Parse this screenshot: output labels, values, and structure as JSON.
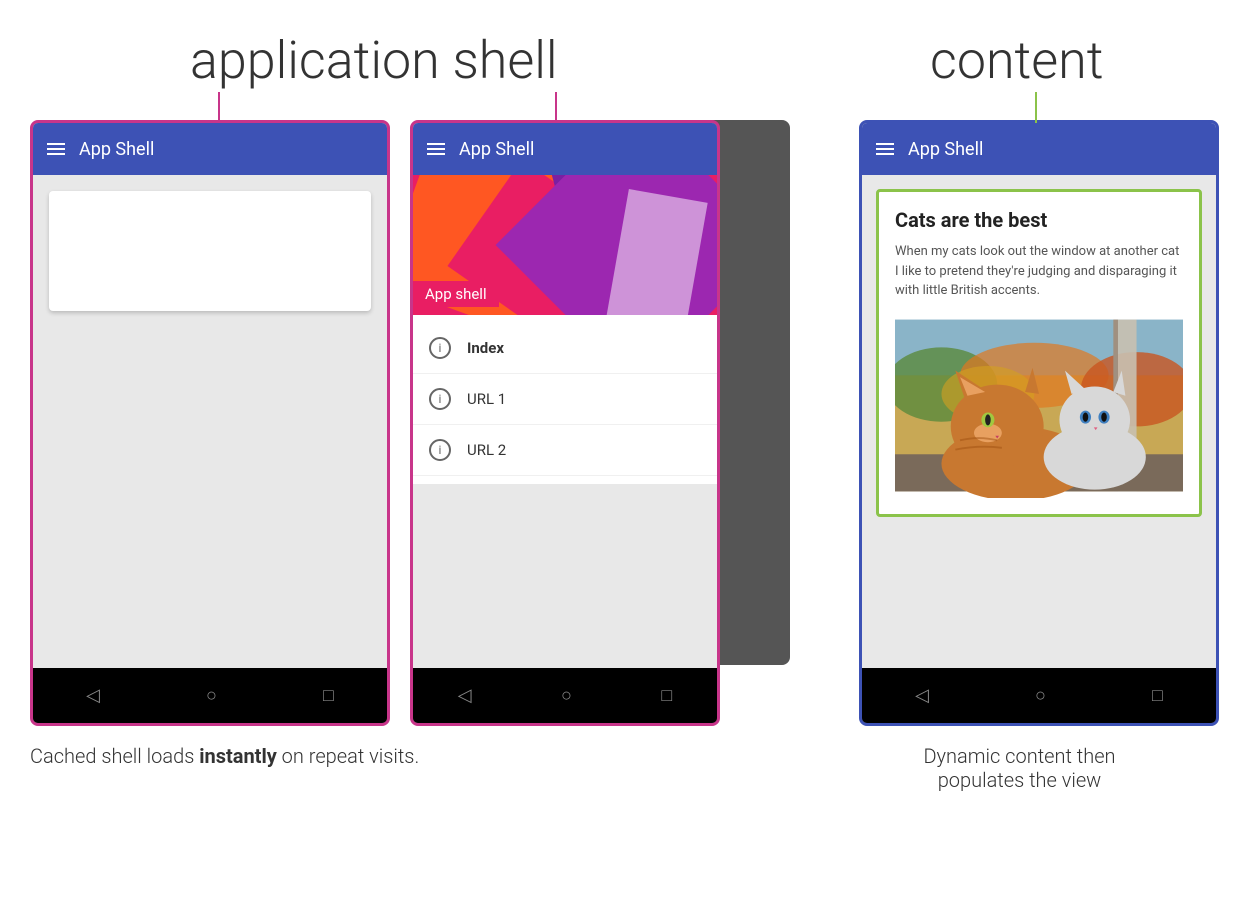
{
  "labels": {
    "app_shell_heading": "application shell",
    "content_heading": "content"
  },
  "phones": {
    "phone1": {
      "toolbar_title": "App Shell",
      "border_color": "#c8358a"
    },
    "phone2": {
      "toolbar_title": "App Shell",
      "border_color": "#c8358a",
      "header_label": "App shell",
      "menu_items": [
        {
          "label": "Index",
          "bold": true
        },
        {
          "label": "URL 1",
          "bold": false
        },
        {
          "label": "URL 2",
          "bold": false
        }
      ]
    },
    "phone3": {
      "toolbar_title": "App Shell",
      "border_color": "#3d52b5",
      "content": {
        "title": "Cats are the best",
        "body": "When my cats look out the window at another cat I like to pretend they're judging and disparaging it with little British accents."
      }
    }
  },
  "nav_icons": {
    "back": "◁",
    "home": "○",
    "recent": "□"
  },
  "captions": {
    "left": "Cached shell loads ",
    "left_bold": "instantly",
    "left_suffix": " on repeat visits.",
    "right_line1": "Dynamic content then",
    "right_line2": "populates the view"
  }
}
